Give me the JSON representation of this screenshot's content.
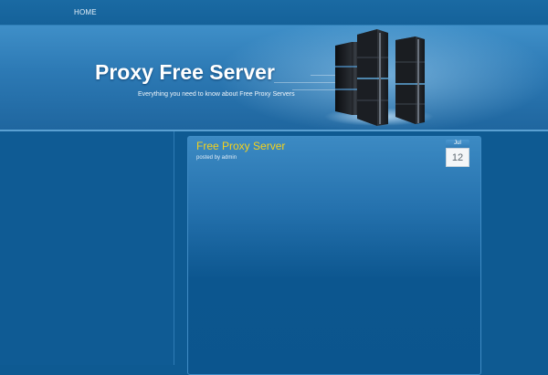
{
  "nav": {
    "items": [
      {
        "label": "HOME"
      }
    ]
  },
  "header": {
    "title": "Proxy Free Server",
    "tagline": "Everything you need to know about Free Proxy Servers",
    "image_icon": "server-rack-icon"
  },
  "post": {
    "title": "Free Proxy Server",
    "meta": "posted by admin",
    "date": {
      "month": "Jul",
      "day": "12"
    }
  },
  "colors": {
    "page_background": "#0e5a92",
    "header_background": "#2c79b4",
    "post_title": "#f5d21c",
    "text_light": "#e4eef7"
  }
}
